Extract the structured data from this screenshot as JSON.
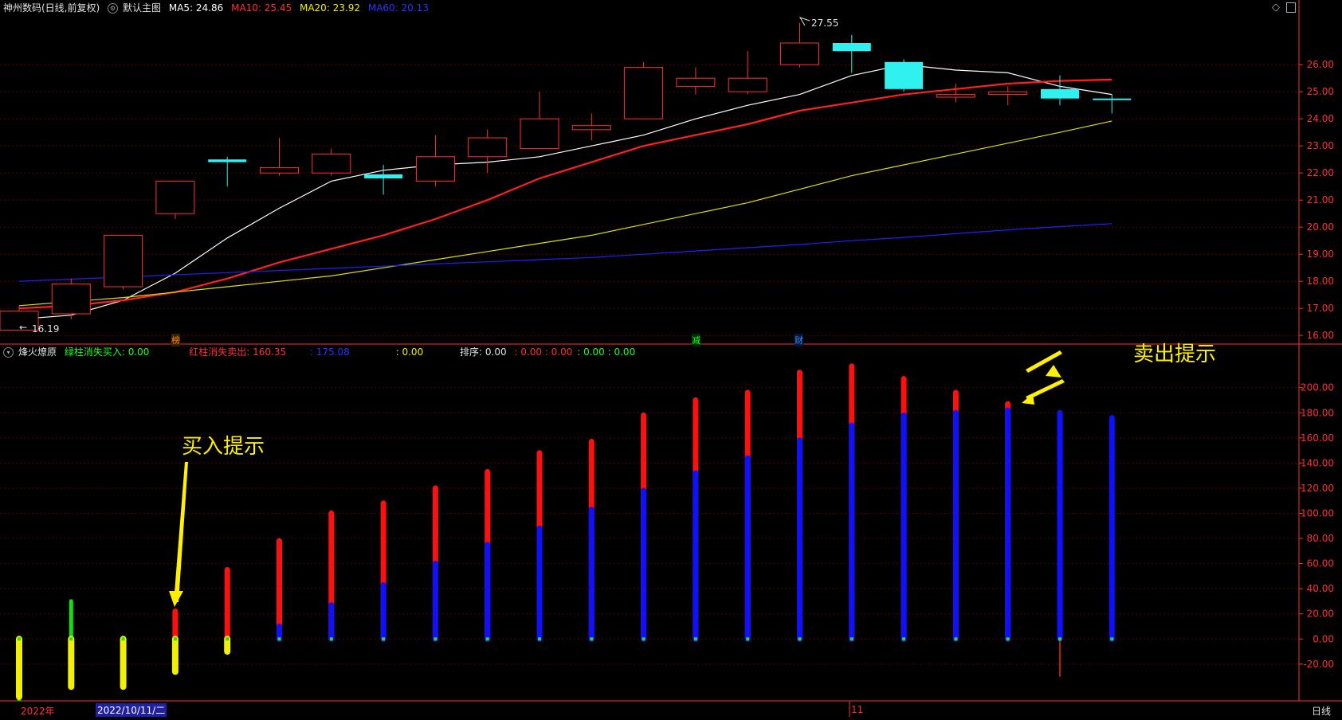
{
  "header": {
    "stock_name": "神州数码(日线,前复权)",
    "main_chart_label": "默认主图",
    "ma5": "MA5: 24.86",
    "ma10": "MA10: 25.45",
    "ma20": "MA20: 23.92",
    "ma60": "MA60: 20.13",
    "icons": [
      "diamond-icon",
      "window-icon"
    ]
  },
  "indicator_header": {
    "name": "烽火燎原",
    "green_label": "绿柱消失买入: 0.00",
    "red_label": "红柱消失卖出: 160.35",
    "blue_label": ": 175.08",
    "yellow_label": ": 0.00",
    "rank_label": "排序: 0.00",
    "red_zeros": ": 0.00 : 0.00",
    "green_zeros": ": 0.00 : 0.00"
  },
  "annotations": {
    "buy": "买入提示",
    "sell": "卖出提示",
    "high_label": "27.55",
    "low_label": "16.19"
  },
  "markers": {
    "m1": "榜",
    "m2": "减",
    "m3": "财"
  },
  "footer": {
    "year": "2022年",
    "date": "2022/10/11/二",
    "month": "11",
    "period": "日线"
  },
  "colors": {
    "up": "#ff3030",
    "down": "#30f0f0",
    "ma5": "#ffffff",
    "ma10": "#ff2020",
    "ma20": "#e0e000",
    "ma60": "#2020ff",
    "axis": "#ff3030",
    "grid": "#5a0000"
  },
  "chart_data": [
    {
      "type": "candlestick",
      "title": "神州数码(日线,前复权)",
      "ylim": [
        15.8,
        27.8
      ],
      "yticks": [
        "16.00",
        "17.00",
        "18.00",
        "19.00",
        "20.00",
        "21.00",
        "22.00",
        "23.00",
        "24.00",
        "25.00",
        "26.00"
      ],
      "ytick_values": [
        16,
        17,
        18,
        19,
        20,
        21,
        22,
        23,
        24,
        25,
        26
      ],
      "candles": [
        {
          "o": 16.2,
          "c": 16.9,
          "h": 17.1,
          "l": 16.19
        },
        {
          "o": 16.8,
          "c": 17.9,
          "h": 18.1,
          "l": 16.6
        },
        {
          "o": 17.8,
          "c": 19.7,
          "h": 19.7,
          "l": 17.7
        },
        {
          "o": 20.5,
          "c": 21.7,
          "h": 21.7,
          "l": 20.3
        },
        {
          "o": 22.5,
          "c": 22.4,
          "h": 22.6,
          "l": 21.5
        },
        {
          "o": 22.0,
          "c": 22.2,
          "h": 23.3,
          "l": 21.9
        },
        {
          "o": 22.0,
          "c": 22.7,
          "h": 22.9,
          "l": 21.9
        },
        {
          "o": 21.95,
          "c": 21.8,
          "h": 22.3,
          "l": 21.2
        },
        {
          "o": 21.7,
          "c": 22.6,
          "h": 23.4,
          "l": 21.5
        },
        {
          "o": 22.6,
          "c": 23.3,
          "h": 23.6,
          "l": 22.0
        },
        {
          "o": 22.9,
          "c": 24.0,
          "h": 25.0,
          "l": 22.9
        },
        {
          "o": 23.6,
          "c": 23.75,
          "h": 24.2,
          "l": 23.2
        },
        {
          "o": 24.0,
          "c": 25.9,
          "h": 26.1,
          "l": 24.0
        },
        {
          "o": 25.2,
          "c": 25.5,
          "h": 25.9,
          "l": 24.9
        },
        {
          "o": 25.0,
          "c": 25.5,
          "h": 26.5,
          "l": 24.9
        },
        {
          "o": 26.0,
          "c": 26.8,
          "h": 27.55,
          "l": 25.9
        },
        {
          "o": 26.8,
          "c": 26.5,
          "h": 27.1,
          "l": 25.7
        },
        {
          "o": 26.1,
          "c": 25.1,
          "h": 26.2,
          "l": 25.0
        },
        {
          "o": 24.8,
          "c": 24.9,
          "h": 25.3,
          "l": 24.6
        },
        {
          "o": 24.9,
          "c": 25.0,
          "h": 25.2,
          "l": 24.5
        },
        {
          "o": 25.1,
          "c": 24.75,
          "h": 25.6,
          "l": 24.5
        },
        {
          "o": 24.75,
          "c": 24.7,
          "h": 24.9,
          "l": 24.2
        }
      ],
      "series": [
        {
          "name": "MA5",
          "values": [
            16.6,
            16.75,
            17.3,
            18.3,
            19.6,
            20.7,
            21.7,
            22.1,
            22.3,
            22.4,
            22.6,
            23.0,
            23.4,
            24.0,
            24.5,
            24.9,
            25.6,
            26.0,
            25.8,
            25.7,
            25.2,
            24.9
          ]
        },
        {
          "name": "MA10",
          "values": [
            17.0,
            17.1,
            17.3,
            17.6,
            18.1,
            18.7,
            19.2,
            19.7,
            20.3,
            21.0,
            21.8,
            22.4,
            23.0,
            23.4,
            23.8,
            24.3,
            24.6,
            24.9,
            25.1,
            25.3,
            25.4,
            25.45
          ]
        },
        {
          "name": "MA20",
          "values": [
            17.1,
            17.25,
            17.4,
            17.6,
            17.8,
            18.0,
            18.2,
            18.5,
            18.8,
            19.1,
            19.4,
            19.7,
            20.1,
            20.5,
            20.9,
            21.4,
            21.9,
            22.3,
            22.7,
            23.1,
            23.5,
            23.92
          ]
        },
        {
          "name": "MA60",
          "values": [
            18.0,
            18.08,
            18.16,
            18.24,
            18.32,
            18.4,
            18.48,
            18.56,
            18.64,
            18.72,
            18.8,
            18.88,
            19.0,
            19.12,
            19.24,
            19.36,
            19.5,
            19.62,
            19.76,
            19.9,
            20.02,
            20.13
          ]
        }
      ]
    },
    {
      "type": "bar",
      "title": "烽火燎原",
      "ylim": [
        -48,
        222
      ],
      "yticks": [
        "-20.00",
        "0.00",
        "20.00",
        "40.00",
        "60.00",
        "80.00",
        "100.00",
        "120.00",
        "140.00",
        "160.00",
        "180.00",
        "200.00"
      ],
      "ytick_values": [
        -20,
        0,
        20,
        40,
        60,
        80,
        100,
        120,
        140,
        160,
        180,
        200
      ],
      "series": [
        {
          "name": "绿柱消失买入",
          "values": [
            -48,
            30,
            0,
            0,
            0,
            0,
            0,
            0,
            0,
            0,
            0,
            0,
            0,
            0,
            0,
            0,
            0,
            0,
            0,
            0,
            0,
            0
          ]
        },
        {
          "name": "红柱消失卖出",
          "values": [
            0,
            0,
            0,
            22,
            55,
            78,
            100,
            108,
            120,
            133,
            148,
            157,
            178,
            190,
            196,
            212,
            217,
            207,
            196,
            187,
            0,
            0
          ]
        },
        {
          "name": "蓝柱",
          "values": [
            0,
            0,
            0,
            0,
            0,
            10,
            27,
            43,
            60,
            75,
            88,
            103,
            118,
            132,
            144,
            158,
            170,
            178,
            180,
            182,
            180,
            176
          ]
        },
        {
          "name": "黄柱",
          "values": [
            -46,
            -38,
            -38,
            -26,
            -10,
            0,
            0,
            0,
            0,
            0,
            0,
            0,
            0,
            0,
            0,
            0,
            0,
            0,
            0,
            0,
            0,
            0
          ]
        },
        {
          "name": "红线",
          "values": [
            0,
            0,
            0,
            0,
            0,
            0,
            0,
            0,
            0,
            0,
            0,
            0,
            0,
            0,
            0,
            0,
            0,
            0,
            0,
            0,
            -30,
            0
          ]
        }
      ]
    }
  ]
}
